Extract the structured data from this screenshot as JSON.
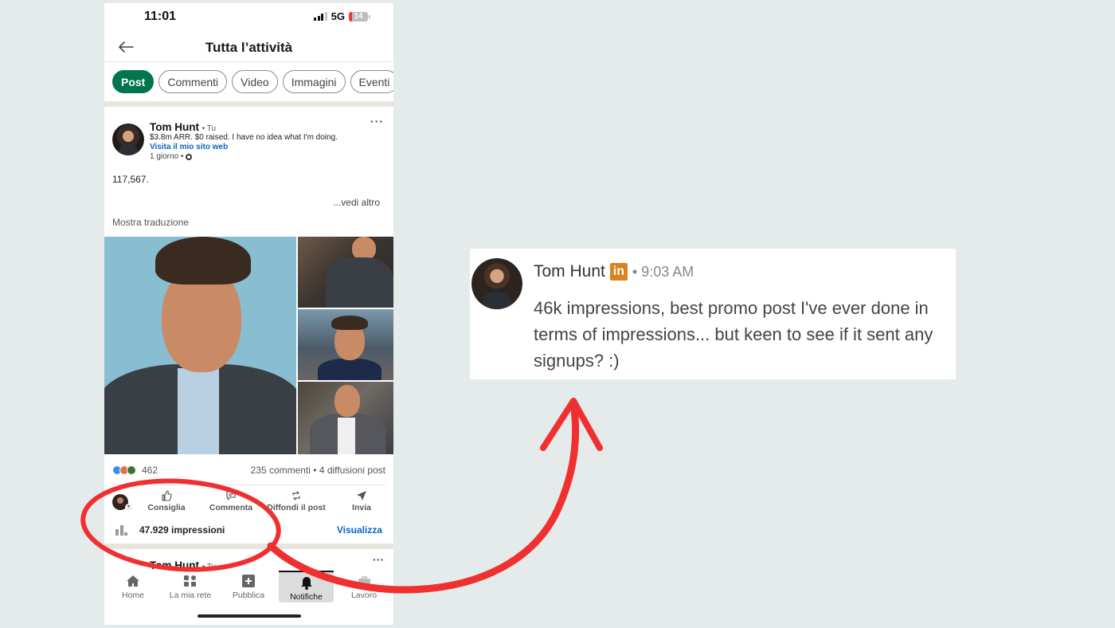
{
  "status_bar": {
    "time": "11:01",
    "network": "5G",
    "battery": "14"
  },
  "header": {
    "title": "Tutta l’attività",
    "back_icon": "arrow-left-icon"
  },
  "filters": [
    {
      "label": "Post",
      "active": true
    },
    {
      "label": "Commenti",
      "active": false
    },
    {
      "label": "Video",
      "active": false
    },
    {
      "label": "Immagini",
      "active": false
    },
    {
      "label": "Eventi",
      "active": false
    }
  ],
  "post": {
    "author": "Tom Hunt",
    "relation": "• Tu",
    "headline": "$3.8m ARR. $0 raised. I have no idea what I'm doing.",
    "website_link": "Visita il mio sito web",
    "age": "1 giorno •",
    "text": "117,567.",
    "see_more": "...vedi altro",
    "translate": "Mostra traduzione",
    "reactions_count": "462",
    "comments_shares": "235 commenti  •  4 diffusioni post",
    "actions": [
      {
        "label": "Consiglia",
        "icon": "thumbs-up-icon"
      },
      {
        "label": "Commenta",
        "icon": "comment-icon"
      },
      {
        "label": "Diffondi il post",
        "icon": "repost-icon"
      },
      {
        "label": "Invia",
        "icon": "send-icon"
      }
    ],
    "impressions": "47.929 impressioni",
    "impressions_link": "Visualizza",
    "reaction_colors": [
      "#378fe9",
      "#df704d",
      "#44712e"
    ]
  },
  "next_post": {
    "author": "Tom Hunt",
    "relation": "• Tu"
  },
  "bottom_nav": [
    {
      "label": "Home",
      "icon": "home-icon",
      "active": false
    },
    {
      "label": "La mia rete",
      "icon": "network-icon",
      "active": false
    },
    {
      "label": "Pubblica",
      "icon": "plus-square-icon",
      "active": false
    },
    {
      "label": "Notifiche",
      "icon": "bell-icon",
      "active": true
    },
    {
      "label": "Lavoro",
      "icon": "briefcase-icon",
      "active": false
    }
  ],
  "chat": {
    "author": "Tom Hunt",
    "badge": "in",
    "time": "• 9:03 AM",
    "message": "46k impressions, best promo post I've ever done in terms of impressions... but keen to see if it sent any signups? :)"
  },
  "colors": {
    "background": "#e5eaea",
    "accent_green": "#01754f",
    "link_blue": "#0a66c2",
    "annotation_red": "#f03030",
    "linkedin_badge": "#d9821e"
  }
}
